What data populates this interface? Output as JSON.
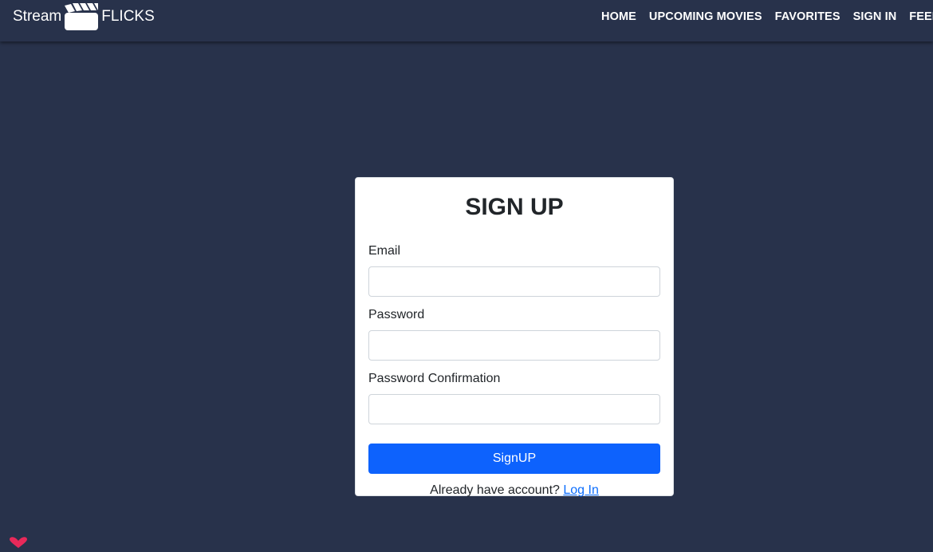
{
  "navbar": {
    "brand": {
      "text_left": "Stream",
      "text_right": "FLICKS",
      "icon": "clapperboard-icon"
    },
    "links": [
      {
        "label": "HOME"
      },
      {
        "label": "UPCOMING MOVIES"
      },
      {
        "label": "FAVORITES"
      },
      {
        "label": "SIGN IN"
      },
      {
        "label": "FEEDBACK"
      }
    ]
  },
  "form": {
    "title": "SIGN UP",
    "email_label": "Email",
    "email_value": "",
    "password_label": "Password",
    "password_value": "",
    "password_confirmation_label": "Password Confirmation",
    "password_confirmation_value": "",
    "submit_label": "SignUP",
    "login_prompt": "Already have account?",
    "login_link": "Log In"
  },
  "colors": {
    "background": "#28324b",
    "primary_button": "#0d62fd",
    "link": "#0d6efd",
    "corner_icon": "#e8295a"
  },
  "corner": {
    "icon": "heart-icon"
  }
}
